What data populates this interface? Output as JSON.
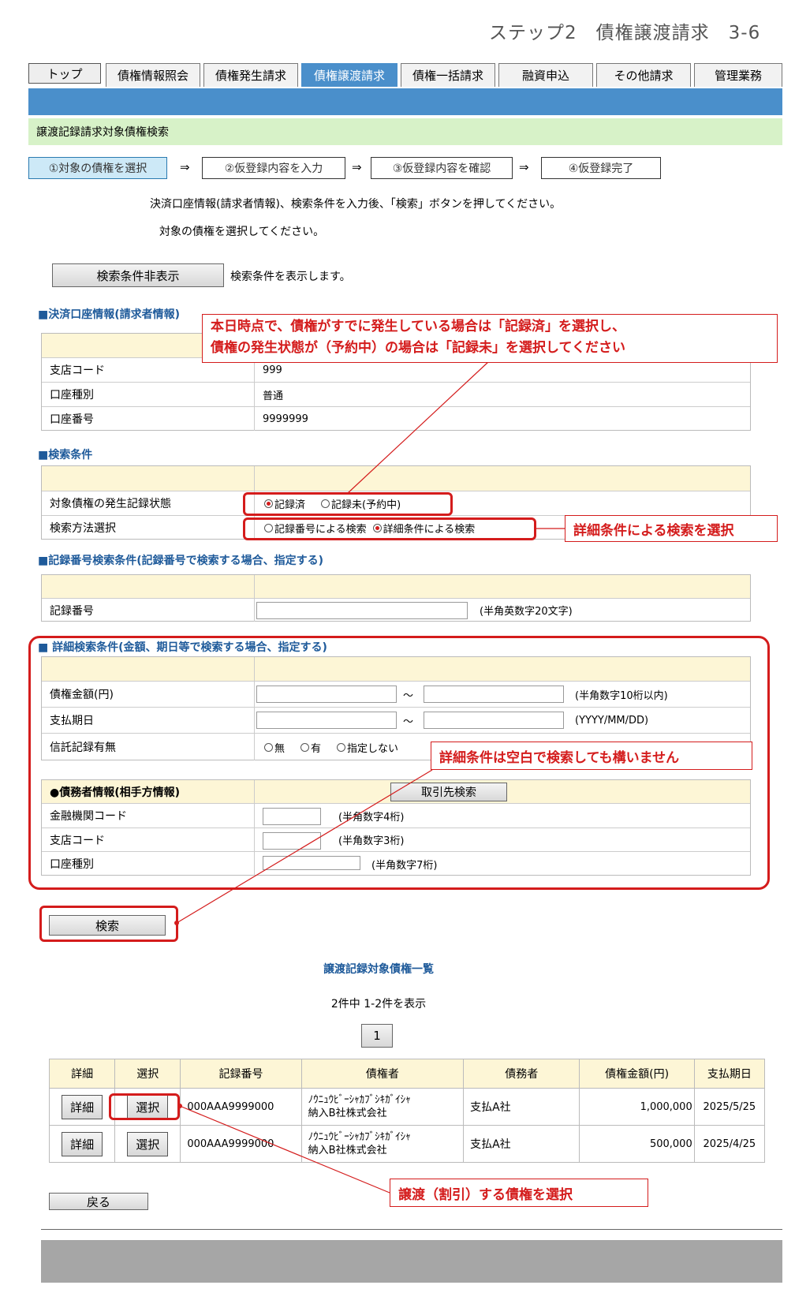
{
  "header": {
    "step_title": "ステップ2　債権譲渡請求　3-6"
  },
  "tabs": {
    "top": "トップ",
    "items": [
      "債権情報照会",
      "債権発生請求",
      "債権譲渡請求",
      "債権一括請求",
      "融資申込",
      "その他請求",
      "管理業務"
    ],
    "active_index": 2
  },
  "page": {
    "heading": "譲渡記録請求対象債権検索"
  },
  "steps": {
    "items": [
      "①対象の債権を選択",
      "②仮登録内容を入力",
      "③仮登録内容を確認",
      "④仮登録完了"
    ],
    "arrow": "⇒"
  },
  "instructions": {
    "line1": "決済口座情報(請求者情報)、検索条件を入力後、「検索」ボタンを押してください。",
    "line2": "対象の債権を選択してください。"
  },
  "toggle": {
    "button": "検索条件非表示",
    "note": "検索条件を表示します。"
  },
  "account": {
    "heading": "■決済口座情報(請求者情報)",
    "rows": [
      {
        "label": "支店コード",
        "value": "999"
      },
      {
        "label": "口座種別",
        "value": "普通"
      },
      {
        "label": "口座番号",
        "value": "9999999"
      }
    ]
  },
  "search": {
    "heading": "■検索条件",
    "status_label": "対象債権の発生記録状態",
    "status_options": [
      "記録済",
      "記録未(予約中)"
    ],
    "method_label": "検索方法選択",
    "method_options": [
      "記録番号による検索",
      "詳細条件による検索"
    ]
  },
  "record": {
    "heading": "■記録番号検索条件(記録番号で検索する場合、指定する)",
    "label": "記録番号",
    "hint": "(半角英数字20文字)"
  },
  "detail": {
    "heading": "■ 詳細検索条件(金額、期日等で検索する場合、指定する)",
    "amount_label": "債権金額(円)",
    "amount_hint": "(半角数字10桁以内)",
    "date_label": "支払期日",
    "date_hint": "(YYYY/MM/DD)",
    "tilde": "～",
    "trust_label": "信託記録有無",
    "trust_options": [
      "無",
      "有",
      "指定しない"
    ],
    "debtor_heading": "●債務者情報(相手方情報)",
    "partner_button": "取引先検索",
    "bank_label": "金融機関コード",
    "bank_hint": "(半角数字4桁)",
    "branch_label": "支店コード",
    "branch_hint": "(半角数字3桁)",
    "acct_label": "口座種別",
    "acct_hint": "(半角数字7桁)"
  },
  "search_button": "検索",
  "results": {
    "title": "譲渡記録対象債権一覧",
    "count": "2件中 1-2件を表示",
    "page": "1",
    "headers": [
      "詳細",
      "選択",
      "記録番号",
      "債権者",
      "債務者",
      "債権金額(円)",
      "支払期日"
    ],
    "detail_btn": "詳細",
    "select_btn": "選択",
    "rows": [
      {
        "record": "000AAA9999000",
        "creditor1": "ﾉｳﾆｭｳﾋﾞｰｼｬｶﾌﾞｼｷｶﾞｲｼｬ",
        "creditor2": "納入B社株式会社",
        "debtor": "支払A社",
        "amount": "1,000,000",
        "date": "2025/5/25"
      },
      {
        "record": "000AAA9999000",
        "creditor1": "ﾉｳﾆｭｳﾋﾞｰｼｬｶﾌﾞｼｷｶﾞｲｼｬ",
        "creditor2": "納入B社株式会社",
        "debtor": "支払A社",
        "amount": "500,000",
        "date": "2025/4/25"
      }
    ]
  },
  "back_button": "戻る",
  "callouts": {
    "c1_line1": "本日時点で、債権がすでに発生している場合は「記録済」を選択し、",
    "c1_line2": "債権の発生状態が（予約中）の場合は「記録未」を選択してください",
    "c2": "詳細条件による検索を選択",
    "c3": "詳細条件は空白で検索しても構いません",
    "c4": "譲渡（割引）する債権を選択",
    "color": "#d41c1c"
  }
}
